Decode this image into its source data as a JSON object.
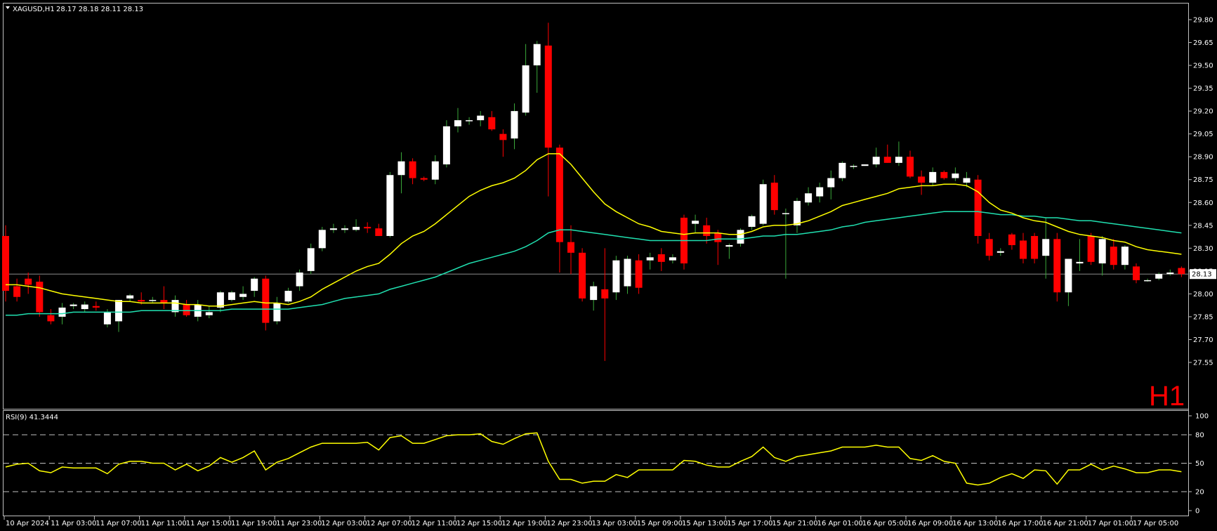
{
  "main": {
    "symbol_info": "XAGUSD,H1",
    "ohlc_text": "28.17 28.18 28.11 28.13",
    "timeframe_label": "H1",
    "current_price_label": "28.13",
    "price_ticks": [
      "29.80",
      "29.65",
      "29.50",
      "29.35",
      "29.20",
      "29.05",
      "28.90",
      "28.75",
      "28.60",
      "28.45",
      "28.30",
      "28.15",
      "28.00",
      "27.85",
      "27.70",
      "27.55"
    ],
    "colors": {
      "bull": "#ffffff",
      "bear": "#ff0000",
      "ma_fast": "#ffff00",
      "ma_slow": "#20e0b0",
      "rsi": "#ffff00",
      "frame": "#c0c0c0"
    }
  },
  "rsi": {
    "label": "RSI(9) 41.3444",
    "ticks": [
      "100",
      "80",
      "50",
      "20",
      "0"
    ]
  },
  "time_axis": {
    "labels": [
      "10 Apr 2024",
      "11 Apr 03:00",
      "11 Apr 07:00",
      "11 Apr 11:00",
      "11 Apr 15:00",
      "11 Apr 19:00",
      "11 Apr 23:00",
      "12 Apr 03:00",
      "12 Apr 07:00",
      "12 Apr 11:00",
      "12 Apr 15:00",
      "12 Apr 19:00",
      "12 Apr 23:00",
      "13 Apr 03:00",
      "15 Apr 09:00",
      "15 Apr 13:00",
      "15 Apr 17:00",
      "15 Apr 21:00",
      "16 Apr 01:00",
      "16 Apr 05:00",
      "16 Apr 09:00",
      "16 Apr 13:00",
      "16 Apr 17:00",
      "16 Apr 21:00",
      "17 Apr 01:00",
      "17 Apr 05:00"
    ]
  },
  "chart_data": {
    "type": "candlestick",
    "symbol": "XAGUSD",
    "timeframe": "H1",
    "ylim": [
      27.52,
      29.85
    ],
    "candles": [
      {
        "o": 28.38,
        "h": 28.45,
        "l": 27.95,
        "c": 28.02
      },
      {
        "o": 28.05,
        "h": 28.1,
        "l": 27.95,
        "c": 27.98
      },
      {
        "o": 28.1,
        "h": 28.14,
        "l": 28.0,
        "c": 28.06
      },
      {
        "o": 28.08,
        "h": 28.12,
        "l": 27.85,
        "c": 27.88
      },
      {
        "o": 27.86,
        "h": 27.9,
        "l": 27.8,
        "c": 27.82
      },
      {
        "o": 27.85,
        "h": 27.94,
        "l": 27.8,
        "c": 27.91
      },
      {
        "o": 27.92,
        "h": 27.94,
        "l": 27.9,
        "c": 27.93
      },
      {
        "o": 27.9,
        "h": 27.95,
        "l": 27.88,
        "c": 27.93
      },
      {
        "o": 27.92,
        "h": 27.95,
        "l": 27.89,
        "c": 27.91
      },
      {
        "o": 27.8,
        "h": 27.9,
        "l": 27.78,
        "c": 27.88
      },
      {
        "o": 27.82,
        "h": 27.96,
        "l": 27.75,
        "c": 27.96
      },
      {
        "o": 27.97,
        "h": 28.0,
        "l": 27.95,
        "c": 27.99
      },
      {
        "o": 27.96,
        "h": 28.01,
        "l": 27.93,
        "c": 27.95
      },
      {
        "o": 27.96,
        "h": 27.98,
        "l": 27.94,
        "c": 27.96
      },
      {
        "o": 27.96,
        "h": 28.05,
        "l": 27.9,
        "c": 27.94
      },
      {
        "o": 27.88,
        "h": 27.99,
        "l": 27.85,
        "c": 27.96
      },
      {
        "o": 27.93,
        "h": 27.96,
        "l": 27.85,
        "c": 27.86
      },
      {
        "o": 27.85,
        "h": 27.96,
        "l": 27.82,
        "c": 27.93
      },
      {
        "o": 27.86,
        "h": 27.92,
        "l": 27.84,
        "c": 27.88
      },
      {
        "o": 27.91,
        "h": 28.02,
        "l": 27.88,
        "c": 28.01
      },
      {
        "o": 27.96,
        "h": 28.02,
        "l": 27.95,
        "c": 28.01
      },
      {
        "o": 27.98,
        "h": 28.05,
        "l": 27.96,
        "c": 28.0
      },
      {
        "o": 28.02,
        "h": 28.11,
        "l": 27.98,
        "c": 28.1
      },
      {
        "o": 28.1,
        "h": 28.12,
        "l": 27.76,
        "c": 27.81
      },
      {
        "o": 27.82,
        "h": 27.98,
        "l": 27.8,
        "c": 27.94
      },
      {
        "o": 27.95,
        "h": 28.04,
        "l": 27.94,
        "c": 28.02
      },
      {
        "o": 28.05,
        "h": 28.16,
        "l": 28.02,
        "c": 28.14
      },
      {
        "o": 28.15,
        "h": 28.33,
        "l": 28.13,
        "c": 28.3
      },
      {
        "o": 28.3,
        "h": 28.44,
        "l": 28.28,
        "c": 28.42
      },
      {
        "o": 28.42,
        "h": 28.46,
        "l": 28.4,
        "c": 28.43
      },
      {
        "o": 28.42,
        "h": 28.45,
        "l": 28.4,
        "c": 28.43
      },
      {
        "o": 28.42,
        "h": 28.49,
        "l": 28.41,
        "c": 28.44
      },
      {
        "o": 28.44,
        "h": 28.47,
        "l": 28.4,
        "c": 28.43
      },
      {
        "o": 28.43,
        "h": 28.46,
        "l": 28.38,
        "c": 28.38
      },
      {
        "o": 28.38,
        "h": 28.8,
        "l": 28.37,
        "c": 28.78
      },
      {
        "o": 28.78,
        "h": 28.93,
        "l": 28.66,
        "c": 28.87
      },
      {
        "o": 28.87,
        "h": 28.89,
        "l": 28.72,
        "c": 28.76
      },
      {
        "o": 28.76,
        "h": 28.77,
        "l": 28.74,
        "c": 28.75
      },
      {
        "o": 28.75,
        "h": 28.91,
        "l": 28.72,
        "c": 28.87
      },
      {
        "o": 28.85,
        "h": 29.14,
        "l": 28.83,
        "c": 29.1
      },
      {
        "o": 29.1,
        "h": 29.22,
        "l": 29.06,
        "c": 29.14
      },
      {
        "o": 29.14,
        "h": 29.16,
        "l": 29.11,
        "c": 29.14
      },
      {
        "o": 29.14,
        "h": 29.2,
        "l": 29.1,
        "c": 29.17
      },
      {
        "o": 29.16,
        "h": 29.2,
        "l": 29.07,
        "c": 29.08
      },
      {
        "o": 29.05,
        "h": 29.08,
        "l": 28.9,
        "c": 29.01
      },
      {
        "o": 29.02,
        "h": 29.25,
        "l": 28.95,
        "c": 29.2
      },
      {
        "o": 29.19,
        "h": 29.64,
        "l": 29.17,
        "c": 29.5
      },
      {
        "o": 29.5,
        "h": 29.66,
        "l": 29.32,
        "c": 29.64
      },
      {
        "o": 29.63,
        "h": 29.78,
        "l": 28.64,
        "c": 28.96
      },
      {
        "o": 28.96,
        "h": 28.98,
        "l": 28.14,
        "c": 28.34
      },
      {
        "o": 28.34,
        "h": 28.45,
        "l": 28.13,
        "c": 28.27
      },
      {
        "o": 28.27,
        "h": 28.3,
        "l": 27.95,
        "c": 27.97
      },
      {
        "o": 27.96,
        "h": 28.08,
        "l": 27.89,
        "c": 28.05
      },
      {
        "o": 28.03,
        "h": 28.3,
        "l": 27.56,
        "c": 27.97
      },
      {
        "o": 28.01,
        "h": 28.25,
        "l": 27.96,
        "c": 28.22
      },
      {
        "o": 28.05,
        "h": 28.25,
        "l": 28.0,
        "c": 28.23
      },
      {
        "o": 28.22,
        "h": 28.26,
        "l": 28.0,
        "c": 28.04
      },
      {
        "o": 28.22,
        "h": 28.27,
        "l": 28.16,
        "c": 28.24
      },
      {
        "o": 28.26,
        "h": 28.3,
        "l": 28.15,
        "c": 28.21
      },
      {
        "o": 28.22,
        "h": 28.26,
        "l": 28.2,
        "c": 28.24
      },
      {
        "o": 28.5,
        "h": 28.52,
        "l": 28.16,
        "c": 28.2
      },
      {
        "o": 28.46,
        "h": 28.52,
        "l": 28.4,
        "c": 28.48
      },
      {
        "o": 28.45,
        "h": 28.5,
        "l": 28.33,
        "c": 28.38
      },
      {
        "o": 28.4,
        "h": 28.42,
        "l": 28.19,
        "c": 28.34
      },
      {
        "o": 28.31,
        "h": 28.33,
        "l": 28.23,
        "c": 28.32
      },
      {
        "o": 28.33,
        "h": 28.43,
        "l": 28.31,
        "c": 28.42
      },
      {
        "o": 28.44,
        "h": 28.52,
        "l": 28.42,
        "c": 28.51
      },
      {
        "o": 28.46,
        "h": 28.75,
        "l": 28.45,
        "c": 28.72
      },
      {
        "o": 28.73,
        "h": 28.78,
        "l": 28.52,
        "c": 28.55
      },
      {
        "o": 28.53,
        "h": 28.56,
        "l": 28.1,
        "c": 28.53
      },
      {
        "o": 28.45,
        "h": 28.63,
        "l": 28.4,
        "c": 28.61
      },
      {
        "o": 28.6,
        "h": 28.7,
        "l": 28.58,
        "c": 28.66
      },
      {
        "o": 28.64,
        "h": 28.73,
        "l": 28.6,
        "c": 28.7
      },
      {
        "o": 28.7,
        "h": 28.81,
        "l": 28.62,
        "c": 28.76
      },
      {
        "o": 28.76,
        "h": 28.87,
        "l": 28.74,
        "c": 28.86
      },
      {
        "o": 28.84,
        "h": 28.85,
        "l": 28.82,
        "c": 28.84
      },
      {
        "o": 28.84,
        "h": 28.85,
        "l": 28.84,
        "c": 28.85
      },
      {
        "o": 28.85,
        "h": 28.96,
        "l": 28.83,
        "c": 28.9
      },
      {
        "o": 28.9,
        "h": 28.98,
        "l": 28.86,
        "c": 28.86
      },
      {
        "o": 28.86,
        "h": 29.0,
        "l": 28.84,
        "c": 28.9
      },
      {
        "o": 28.9,
        "h": 28.94,
        "l": 28.76,
        "c": 28.77
      },
      {
        "o": 28.77,
        "h": 28.81,
        "l": 28.65,
        "c": 28.73
      },
      {
        "o": 28.73,
        "h": 28.83,
        "l": 28.71,
        "c": 28.8
      },
      {
        "o": 28.8,
        "h": 28.81,
        "l": 28.75,
        "c": 28.76
      },
      {
        "o": 28.76,
        "h": 28.83,
        "l": 28.74,
        "c": 28.79
      },
      {
        "o": 28.73,
        "h": 28.8,
        "l": 28.7,
        "c": 28.76
      },
      {
        "o": 28.75,
        "h": 28.78,
        "l": 28.33,
        "c": 28.38
      },
      {
        "o": 28.36,
        "h": 28.4,
        "l": 28.22,
        "c": 28.25
      },
      {
        "o": 28.27,
        "h": 28.3,
        "l": 28.25,
        "c": 28.28
      },
      {
        "o": 28.39,
        "h": 28.4,
        "l": 28.29,
        "c": 28.32
      },
      {
        "o": 28.35,
        "h": 28.4,
        "l": 28.2,
        "c": 28.23
      },
      {
        "o": 28.38,
        "h": 28.4,
        "l": 28.2,
        "c": 28.23
      },
      {
        "o": 28.25,
        "h": 28.5,
        "l": 28.1,
        "c": 28.36
      },
      {
        "o": 28.36,
        "h": 28.4,
        "l": 27.95,
        "c": 28.01
      },
      {
        "o": 28.01,
        "h": 28.23,
        "l": 27.92,
        "c": 28.23
      },
      {
        "o": 28.2,
        "h": 28.36,
        "l": 28.15,
        "c": 28.21
      },
      {
        "o": 28.38,
        "h": 28.4,
        "l": 28.19,
        "c": 28.21
      },
      {
        "o": 28.2,
        "h": 28.38,
        "l": 28.12,
        "c": 28.36
      },
      {
        "o": 28.31,
        "h": 28.36,
        "l": 28.16,
        "c": 28.19
      },
      {
        "o": 28.19,
        "h": 28.32,
        "l": 28.16,
        "c": 28.31
      },
      {
        "o": 28.18,
        "h": 28.2,
        "l": 28.07,
        "c": 28.09
      },
      {
        "o": 28.09,
        "h": 28.1,
        "l": 28.08,
        "c": 28.09
      },
      {
        "o": 28.1,
        "h": 28.14,
        "l": 28.09,
        "c": 28.13
      },
      {
        "o": 28.13,
        "h": 28.16,
        "l": 28.12,
        "c": 28.14
      },
      {
        "o": 28.17,
        "h": 28.18,
        "l": 28.11,
        "c": 28.13
      }
    ],
    "ma_fast": [
      28.06,
      28.06,
      28.05,
      28.04,
      28.02,
      28.0,
      27.99,
      27.98,
      27.97,
      27.96,
      27.95,
      27.95,
      27.94,
      27.94,
      27.94,
      27.94,
      27.93,
      27.93,
      27.92,
      27.92,
      27.93,
      27.94,
      27.95,
      27.94,
      27.94,
      27.93,
      27.95,
      27.98,
      28.03,
      28.07,
      28.11,
      28.15,
      28.18,
      28.2,
      28.26,
      28.33,
      28.38,
      28.41,
      28.46,
      28.52,
      28.58,
      28.64,
      28.68,
      28.71,
      28.73,
      28.76,
      28.81,
      28.88,
      28.92,
      28.92,
      28.85,
      28.76,
      28.67,
      28.59,
      28.54,
      28.5,
      28.46,
      28.44,
      28.41,
      28.4,
      28.39,
      28.4,
      28.4,
      28.4,
      28.39,
      28.39,
      28.41,
      28.44,
      28.45,
      28.45,
      28.46,
      28.48,
      28.51,
      28.54,
      28.58,
      28.6,
      28.62,
      28.64,
      28.66,
      28.69,
      28.7,
      28.71,
      28.71,
      28.72,
      28.72,
      28.71,
      28.67,
      28.6,
      28.55,
      28.53,
      28.5,
      28.48,
      28.47,
      28.44,
      28.41,
      28.39,
      28.38,
      28.37,
      28.35,
      28.34,
      28.31,
      28.29,
      28.28,
      28.27,
      28.26
    ],
    "ma_slow": [
      27.86,
      27.86,
      27.87,
      27.87,
      27.87,
      27.87,
      27.88,
      27.88,
      27.88,
      27.88,
      27.88,
      27.88,
      27.89,
      27.89,
      27.89,
      27.89,
      27.89,
      27.89,
      27.89,
      27.89,
      27.9,
      27.9,
      27.9,
      27.9,
      27.9,
      27.9,
      27.91,
      27.92,
      27.93,
      27.95,
      27.97,
      27.98,
      27.99,
      28.0,
      28.03,
      28.05,
      28.07,
      28.09,
      28.11,
      28.14,
      28.17,
      28.2,
      28.22,
      28.24,
      28.26,
      28.28,
      28.31,
      28.35,
      28.4,
      28.42,
      28.42,
      28.41,
      28.4,
      28.39,
      28.38,
      28.37,
      28.36,
      28.35,
      28.35,
      28.35,
      28.35,
      28.35,
      28.35,
      28.36,
      28.36,
      28.36,
      28.37,
      28.38,
      28.38,
      28.39,
      28.39,
      28.4,
      28.41,
      28.42,
      28.44,
      28.45,
      28.47,
      28.48,
      28.49,
      28.5,
      28.51,
      28.52,
      28.53,
      28.54,
      28.54,
      28.54,
      28.54,
      28.53,
      28.52,
      28.52,
      28.51,
      28.51,
      28.5,
      28.5,
      28.49,
      28.48,
      28.48,
      28.47,
      28.46,
      28.45,
      28.44,
      28.43,
      28.42,
      28.41,
      28.4
    ],
    "rsi_values": [
      46,
      49,
      50,
      42,
      40,
      46,
      45,
      45,
      45,
      39,
      49,
      52,
      52,
      50,
      50,
      43,
      49,
      42,
      47,
      56,
      51,
      56,
      63,
      43,
      51,
      55,
      61,
      67,
      71,
      71,
      71,
      71,
      72,
      64,
      77,
      79,
      71,
      71,
      75,
      79,
      80,
      80,
      81,
      73,
      70,
      76,
      81,
      82,
      52,
      33,
      33,
      29,
      31,
      31,
      38,
      35,
      43,
      43,
      43,
      43,
      53,
      52,
      48,
      46,
      46,
      52,
      57,
      67,
      56,
      52,
      57,
      59,
      61,
      63,
      67,
      67,
      67,
      69,
      67,
      67,
      55,
      53,
      58,
      52,
      50,
      29,
      27,
      29,
      35,
      39,
      34,
      43,
      42,
      28,
      43,
      43,
      49,
      43,
      47,
      44,
      40,
      40,
      43,
      43,
      41
    ],
    "rsi_levels": [
      80,
      50,
      20
    ],
    "rsi_ylim": [
      0,
      100
    ]
  }
}
